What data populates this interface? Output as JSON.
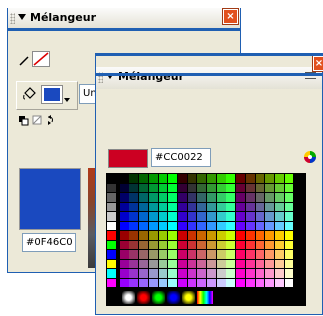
{
  "back_window": {
    "title": "Mélangeur",
    "close_glyph": "×",
    "fill_style": "Uni",
    "hex_value": "#0F46C0",
    "fill_color": "#1a49bf",
    "options_icon": "panel-options-icon"
  },
  "front_window": {
    "title": "Mélangeur",
    "close_glyph": "×",
    "hex_value": "#CC0022",
    "current_color": "#cc0022",
    "options_icon": "panel-options-icon"
  },
  "palette": {
    "description_note": "web-safe 216 color grid with grayscale and primary column",
    "left_column_colors": [
      "#000000",
      "#333333",
      "#666666",
      "#999999",
      "#cccccc",
      "#ffffff",
      "#ff0000",
      "#00ff00",
      "#0000ff",
      "#ffff00",
      "#00ffff",
      "#ff00ff"
    ],
    "gradient_swatches": [
      "#000000",
      "#ffffff",
      "#ff0000",
      "#00ff00",
      "#0000ff",
      "#ffff00"
    ]
  }
}
